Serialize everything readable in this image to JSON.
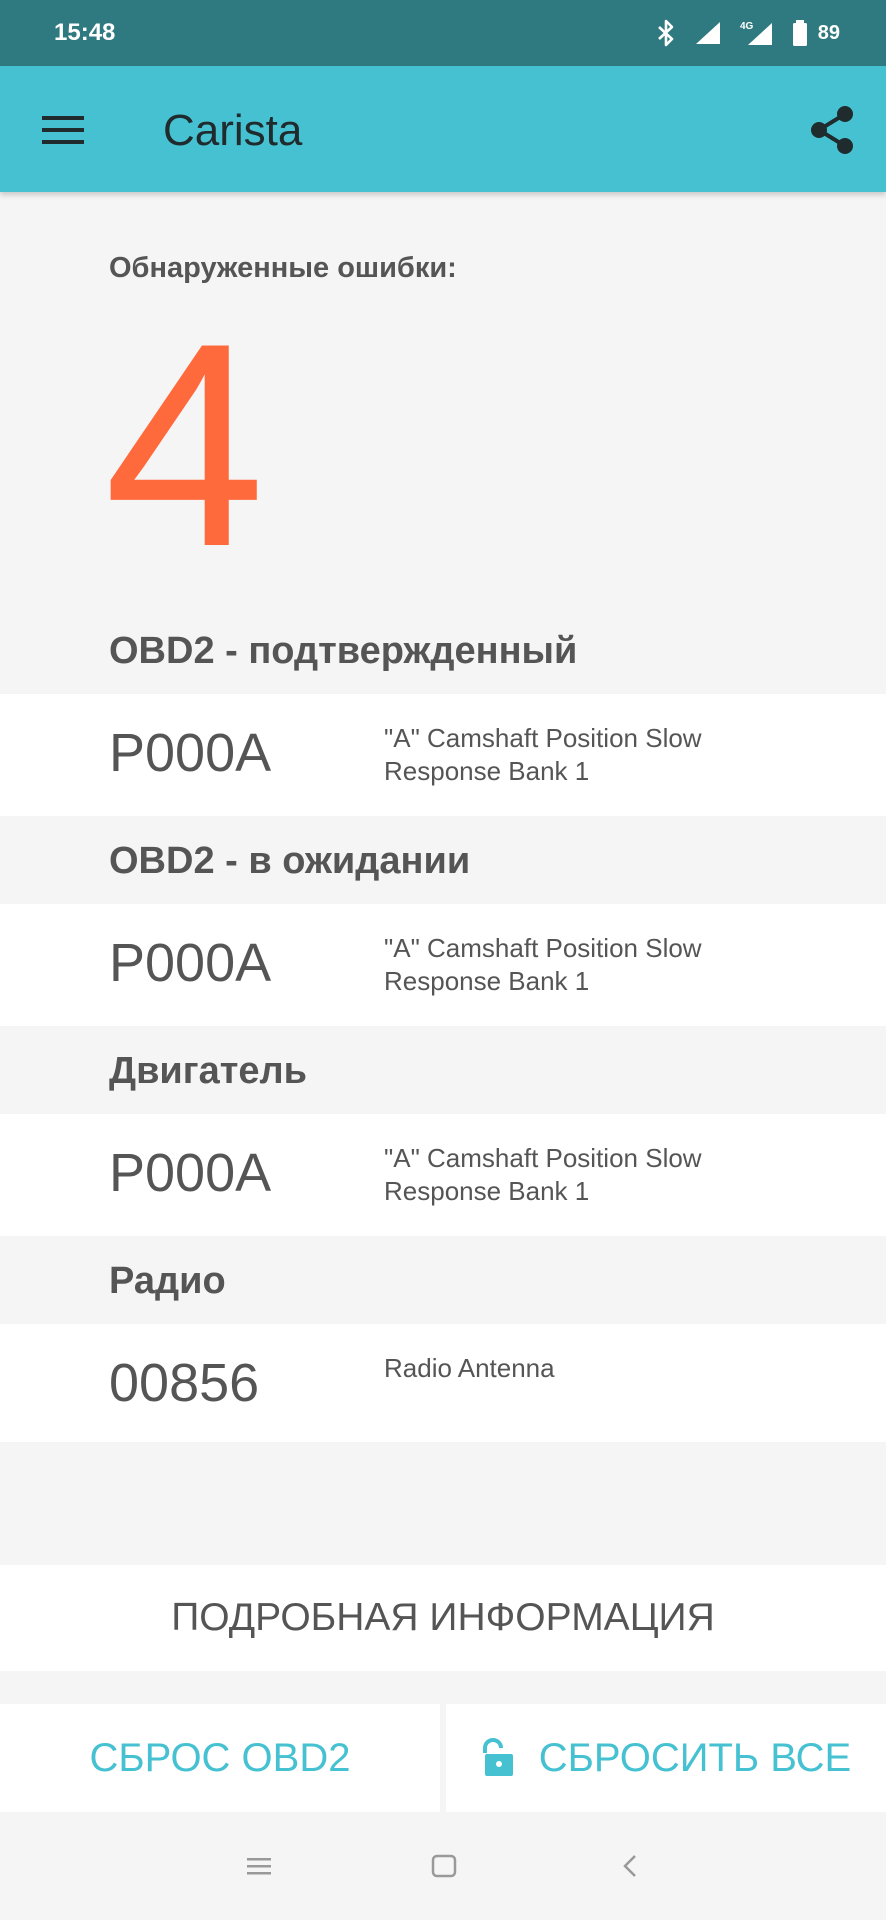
{
  "status_bar": {
    "time": "15:48",
    "battery_percent": "89",
    "network_label": "4G",
    "icons": [
      "bluetooth-icon",
      "signal-icon",
      "signal-4g-icon",
      "battery-icon"
    ]
  },
  "app_bar": {
    "title": "Carista",
    "menu_icon": "hamburger-menu-icon",
    "share_icon": "share-icon",
    "background_color": "#46c1d2"
  },
  "summary": {
    "label": "Обнаруженные ошибки:",
    "count": "4",
    "count_color": "#ff6a3d"
  },
  "sections": [
    {
      "title": "OBD2 - подтвержденный",
      "faults": [
        {
          "code": "P000A",
          "description": "\"A\" Camshaft Position Slow Response Bank 1"
        }
      ]
    },
    {
      "title": "OBD2 - в ожидании",
      "faults": [
        {
          "code": "P000A",
          "description": "\"A\" Camshaft Position Slow Response Bank 1"
        }
      ]
    },
    {
      "title": "Двигатель",
      "faults": [
        {
          "code": "P000A",
          "description": "\"A\" Camshaft Position Slow Response Bank 1"
        }
      ]
    },
    {
      "title": "Радио",
      "faults": [
        {
          "code": "00856",
          "description": "Radio Antenna"
        }
      ]
    }
  ],
  "buttons": {
    "details": "ПОДРОБНАЯ ИНФОРМАЦИЯ",
    "reset_obd2": "СБРОС OBD2",
    "reset_all": "СБРОСИТЬ ВСЕ",
    "reset_all_icon": "unlocked-padlock-icon",
    "accent_color": "#46c1d2"
  },
  "nav_bar": {
    "icons": [
      "recent-apps-icon",
      "home-icon",
      "back-icon"
    ]
  }
}
